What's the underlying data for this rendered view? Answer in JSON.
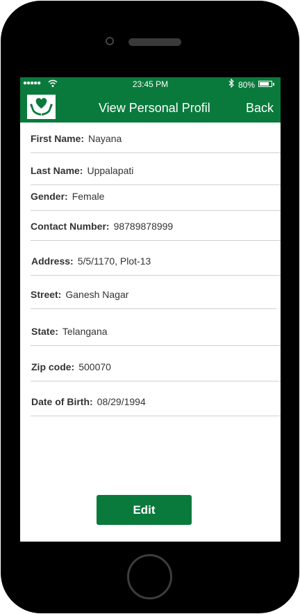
{
  "status_bar": {
    "signal": "●●●●●",
    "time": "23:45 PM",
    "battery_pct": "80%",
    "battery_level": 0.8,
    "bluetooth_icon": "bluetooth-icon",
    "wifi_icon": "wifi-icon"
  },
  "nav": {
    "title": "View Personal  Profil",
    "back_label": "Back",
    "logo_icon": "hands-heart-logo"
  },
  "profile": [
    {
      "label": "First Name:",
      "value": "Nayana"
    },
    {
      "label": "Last Name:",
      "value": "Uppalapati"
    },
    {
      "label": "Gender:",
      "value": "Female"
    },
    {
      "label": "Contact Number:",
      "value": "98789878999"
    },
    {
      "label": "Address:",
      "value": "5/5/1170, Plot-13"
    },
    {
      "label": "Street:",
      "value": "Ganesh Nagar"
    },
    {
      "label": "State:",
      "value": "Telangana"
    },
    {
      "label": "Zip code:",
      "value": "500070"
    },
    {
      "label": "Date of Birth:",
      "value": "08/29/1994"
    }
  ],
  "actions": {
    "edit_label": "Edit"
  },
  "colors": {
    "brand_green": "#0a7a3c",
    "phone_body": "#000000"
  }
}
